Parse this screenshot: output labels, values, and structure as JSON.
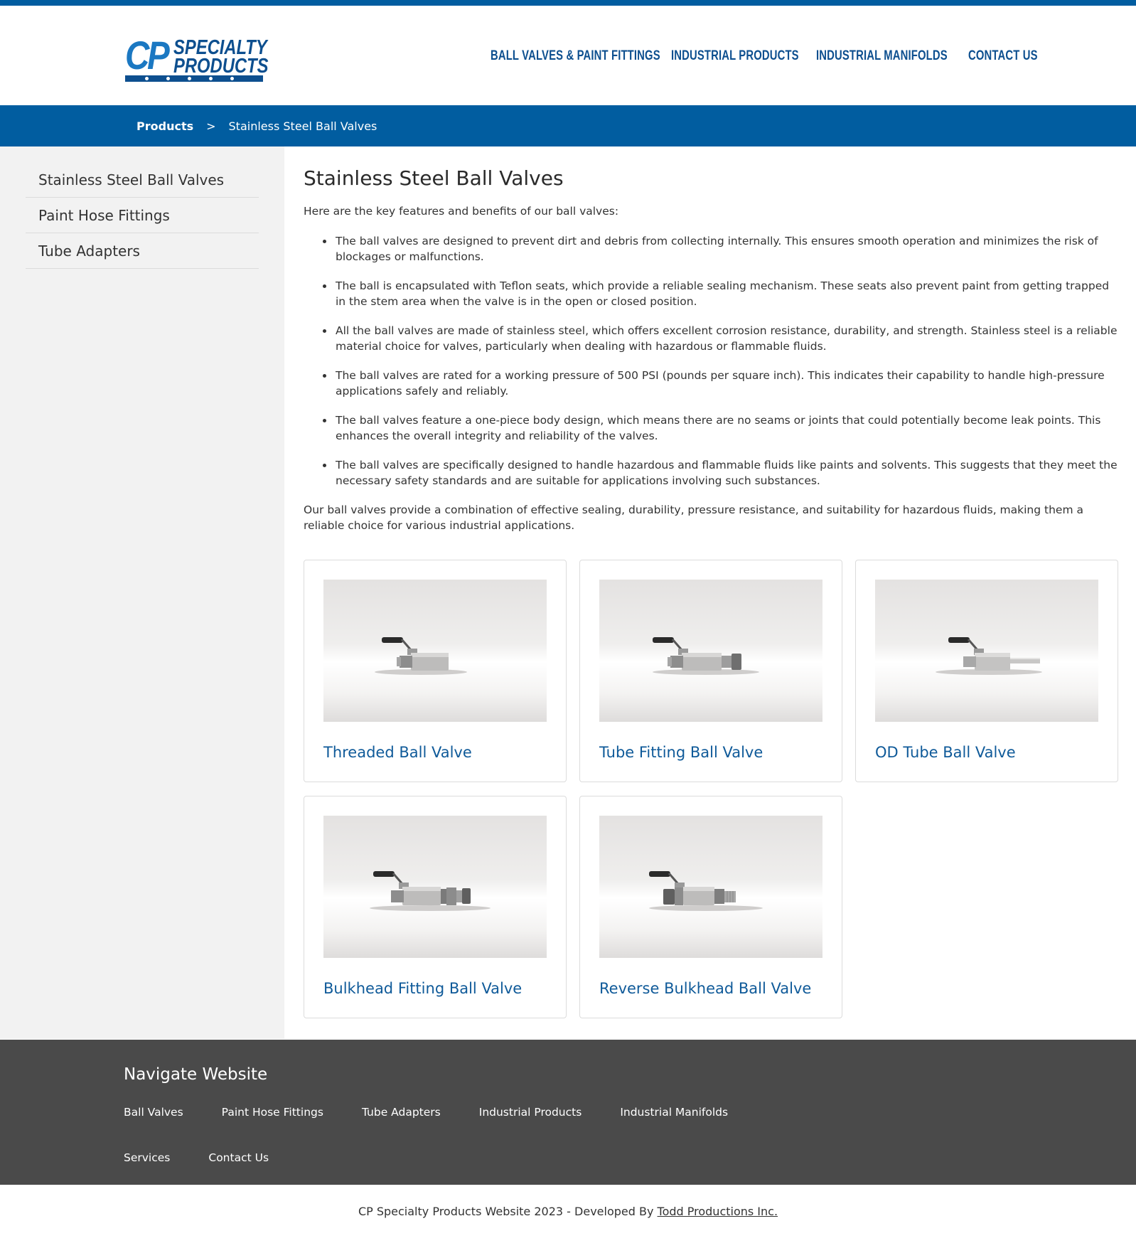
{
  "brand": {
    "logo_cp": "CP",
    "logo_line1": "SPECIALTY",
    "logo_line2": "PRODUCTS",
    "primary_color": "#015da0",
    "link_color": "#0f5a99",
    "footer_bg": "#4a4a4a"
  },
  "nav": {
    "items": [
      {
        "label": "BALL VALVES & PAINT FITTINGS"
      },
      {
        "label": "INDUSTRIAL PRODUCTS"
      },
      {
        "label": "INDUSTRIAL MANIFOLDS"
      },
      {
        "label": "CONTACT US"
      }
    ]
  },
  "breadcrumb": {
    "parent": "Products",
    "separator": ">",
    "current": "Stainless Steel Ball Valves"
  },
  "sidebar": {
    "items": [
      {
        "label": "Stainless Steel Ball Valves"
      },
      {
        "label": "Paint Hose Fittings"
      },
      {
        "label": "Tube Adapters"
      }
    ]
  },
  "content": {
    "title": "Stainless Steel Ball Valves",
    "intro": "Here are the key features and benefits of our ball valves:",
    "features": [
      "The ball valves are designed to prevent dirt and debris from collecting internally. This ensures smooth operation and minimizes the risk of blockages or malfunctions.",
      "The ball is encapsulated with Teflon seats, which provide a reliable sealing mechanism. These seats also prevent paint from getting trapped in the stem area when the valve is in the open or closed position.",
      "All the ball valves are made of stainless steel, which offers excellent corrosion resistance, durability, and strength. Stainless steel is a reliable material choice for valves, particularly when dealing with hazardous or flammable fluids.",
      "The ball valves are rated for a working pressure of 500 PSI (pounds per square inch). This indicates their capability to handle high-pressure applications safely and reliably.",
      "The ball valves feature a one-piece body design, which means there are no seams or joints that could potentially become leak points. This enhances the overall integrity and reliability of the valves.",
      "The ball valves are specifically designed to handle hazardous and flammable fluids like paints and solvents. This suggests that they meet the necessary safety standards and are suitable for applications involving such substances."
    ],
    "summary": "Our ball valves provide a combination of effective sealing, durability, pressure resistance, and suitability for hazardous fluids, making them a reliable choice for various industrial applications."
  },
  "products": [
    {
      "name": "Threaded Ball Valve",
      "icon": "threaded-ball-valve-photo"
    },
    {
      "name": "Tube Fitting Ball Valve",
      "icon": "tube-fitting-ball-valve-photo"
    },
    {
      "name": "OD Tube Ball Valve",
      "icon": "od-tube-ball-valve-photo"
    },
    {
      "name": "Bulkhead Fitting Ball Valve",
      "icon": "bulkhead-fitting-ball-valve-photo"
    },
    {
      "name": "Reverse Bulkhead Ball Valve",
      "icon": "reverse-bulkhead-ball-valve-photo"
    }
  ],
  "footer": {
    "heading": "Navigate Website",
    "links": [
      {
        "label": "Ball Valves"
      },
      {
        "label": "Paint Hose Fittings"
      },
      {
        "label": "Tube Adapters"
      },
      {
        "label": "Industrial Products"
      },
      {
        "label": "Industrial Manifolds"
      },
      {
        "label": "Services"
      },
      {
        "label": "Contact Us"
      }
    ],
    "copyright_text": "CP Specialty Products Website 2023 - Developed By",
    "developer_link": "Todd Productions Inc."
  }
}
